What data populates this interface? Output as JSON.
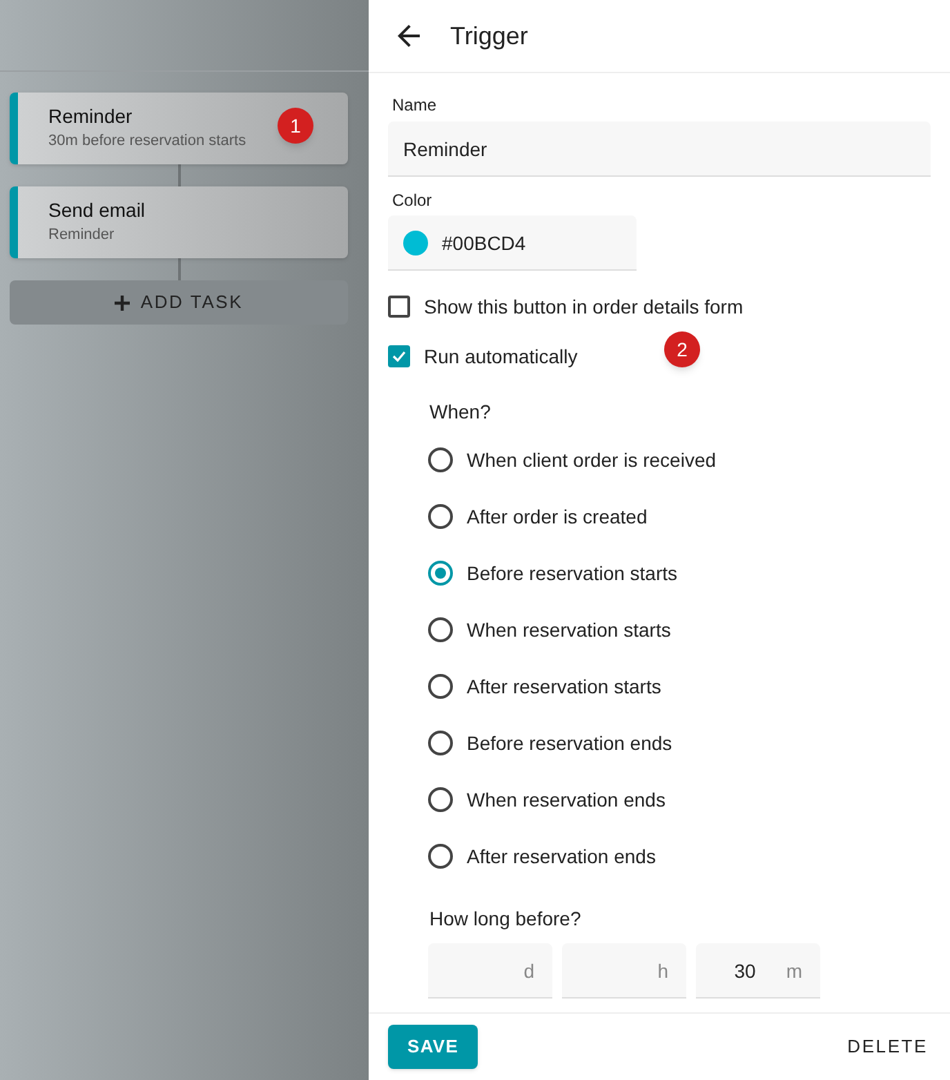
{
  "tasks": [
    {
      "title": "Reminder",
      "subtitle": "30m before reservation starts",
      "marker": "1"
    },
    {
      "title": "Send email",
      "subtitle": "Reminder"
    }
  ],
  "add_task_button": "ADD TASK",
  "panel": {
    "title": "Trigger"
  },
  "name_field": {
    "label": "Name",
    "value": "Reminder"
  },
  "color_field": {
    "label": "Color",
    "value": "#00BCD4",
    "color": "#00bcd4"
  },
  "checkboxes": [
    {
      "label": "Show this button in order details form",
      "checked": false
    },
    {
      "label": "Run automatically",
      "checked": true,
      "marker": "2"
    }
  ],
  "when": {
    "label": "When?",
    "options": [
      {
        "label": "When client order is received",
        "selected": false
      },
      {
        "label": "After order is created",
        "selected": false
      },
      {
        "label": "Before reservation starts",
        "selected": true
      },
      {
        "label": "When reservation starts",
        "selected": false
      },
      {
        "label": "After reservation starts",
        "selected": false
      },
      {
        "label": "Before reservation ends",
        "selected": false
      },
      {
        "label": "When reservation ends",
        "selected": false
      },
      {
        "label": "After reservation ends",
        "selected": false
      }
    ]
  },
  "duration": {
    "label": "How long before?",
    "fields": [
      {
        "unit": "d"
      },
      {
        "unit": "h"
      },
      {
        "unit": "m",
        "value": "30"
      }
    ]
  },
  "footer": {
    "save": "SAVE",
    "delete": "DELETE"
  }
}
